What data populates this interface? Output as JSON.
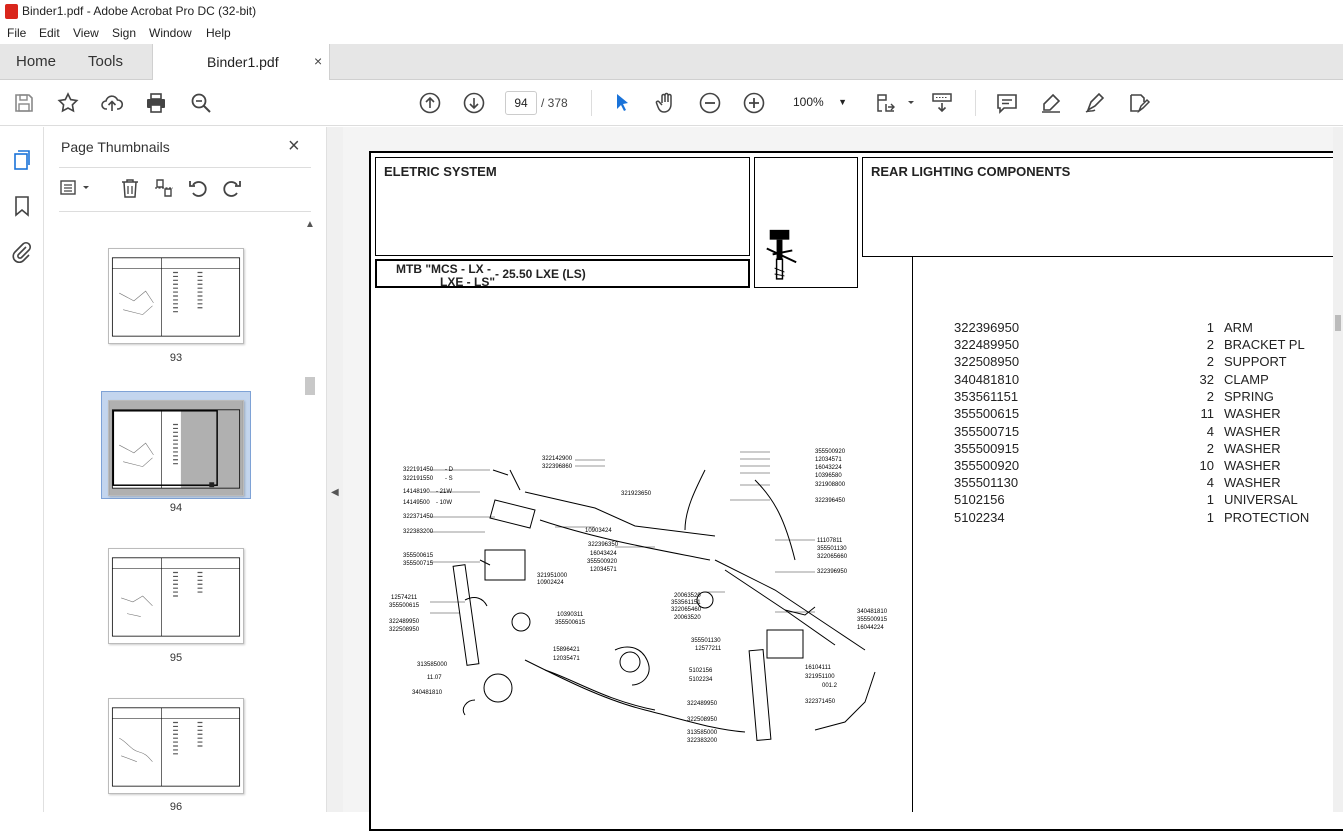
{
  "window": {
    "title": "Binder1.pdf - Adobe Acrobat Pro DC (32-bit)"
  },
  "menu": [
    "File",
    "Edit",
    "View",
    "Sign",
    "Window",
    "Help"
  ],
  "tabs": {
    "home": "Home",
    "tools": "Tools",
    "document": "Binder1.pdf",
    "close": "×"
  },
  "toolbar": {
    "page_current": "94",
    "page_total": "/ 378",
    "zoom": "100%"
  },
  "panel": {
    "title": "Page Thumbnails",
    "close": "×",
    "thumbnails": [
      {
        "number": "93"
      },
      {
        "number": "94",
        "selected": true
      },
      {
        "number": "95"
      },
      {
        "number": "96"
      }
    ]
  },
  "document": {
    "section": "ELETRIC SYSTEM",
    "heading": "REAR LIGHTING COMPONENTS",
    "model_line1": "MTB \"MCS - LX -",
    "model_line2": "LXE - LS\"",
    "model_suffix": "- 25.50 LXE (LS)",
    "parts": [
      {
        "part": "322396950",
        "qty": "1",
        "desc": "ARM"
      },
      {
        "part": "322489950",
        "qty": "2",
        "desc": "BRACKET PL"
      },
      {
        "part": "322508950",
        "qty": "2",
        "desc": "SUPPORT"
      },
      {
        "part": "340481810",
        "qty": "32",
        "desc": "CLAMP"
      },
      {
        "part": "353561151",
        "qty": "2",
        "desc": "SPRING"
      },
      {
        "part": "355500615",
        "qty": "11",
        "desc": "WASHER"
      },
      {
        "part": "355500715",
        "qty": "4",
        "desc": "WASHER"
      },
      {
        "part": "355500915",
        "qty": "2",
        "desc": "WASHER"
      },
      {
        "part": "355500920",
        "qty": "10",
        "desc": "WASHER"
      },
      {
        "part": "355501130",
        "qty": "4",
        "desc": "WASHER"
      },
      {
        "part": "5102156",
        "qty": "1",
        "desc": "UNIVERSAL"
      },
      {
        "part": "5102234",
        "qty": "1",
        "desc": "PROTECTION"
      }
    ],
    "diagram_labels": [
      "322191450",
      "- D",
      "322191550",
      "- S",
      "14148190",
      "- 21W",
      "14149500",
      "- 10W",
      "322371450",
      "322383200",
      "355500615",
      "355500715",
      "12574211",
      "355500615",
      "322489950",
      "322508950",
      "313585000",
      "11.07",
      "340481810",
      "322142900",
      "322396860",
      "321923650",
      "10903424",
      "322396350",
      "16043424",
      "355500920",
      "12034571",
      "321951000",
      "10902424",
      "10390311",
      "355500615",
      "15896421",
      "12035471",
      "20063520",
      "353561151",
      "322065460",
      "20063520",
      "355501130",
      "12577211",
      "5102156",
      "5102234",
      "322489950",
      "322508950",
      "313585000",
      "322383200",
      "355500920",
      "12034571",
      "16043224",
      "10396580",
      "321908800",
      "322396450",
      "11107811",
      "355501130",
      "322065660",
      "322396950",
      "340481810",
      "355500915",
      "16044224",
      "16104111",
      "321951100",
      "001.2",
      "322371450"
    ]
  }
}
